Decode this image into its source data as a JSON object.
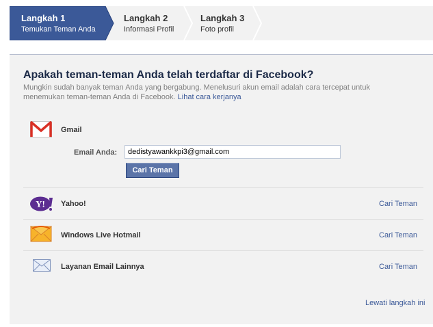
{
  "steps": [
    {
      "title": "Langkah 1",
      "subtitle": "Temukan Teman Anda",
      "active": true
    },
    {
      "title": "Langkah 2",
      "subtitle": "Informasi Profil",
      "active": false
    },
    {
      "title": "Langkah 3",
      "subtitle": "Foto profil",
      "active": false
    }
  ],
  "main": {
    "title": "Apakah teman-teman Anda telah terdaftar di Facebook?",
    "description": "Mungkin sudah banyak teman Anda yang bergabung. Menelusuri akun email adalah cara tercepat untuk menemukan teman-teman Anda di Facebook.",
    "how_it_works_link": "Lihat cara kerjanya"
  },
  "gmail": {
    "name": "Gmail",
    "email_label": "Email Anda:",
    "email_value": "dedistyawankkpi3@gmail.com",
    "button_label": "Cari Teman"
  },
  "providers": [
    {
      "name": "Yahoo!",
      "action": "Cari Teman",
      "icon": "yahoo-icon"
    },
    {
      "name": "Windows Live Hotmail",
      "action": "Cari Teman",
      "icon": "hotmail-icon"
    },
    {
      "name": "Layanan Email Lainnya",
      "action": "Cari Teman",
      "icon": "envelope-icon"
    }
  ],
  "skip_link": "Lewati langkah ini",
  "colors": {
    "active_step": "#3b5998",
    "link": "#3b5998",
    "title": "#1c2a47",
    "button": "#5b74a8",
    "panel_bg": "#f2f2f2"
  }
}
